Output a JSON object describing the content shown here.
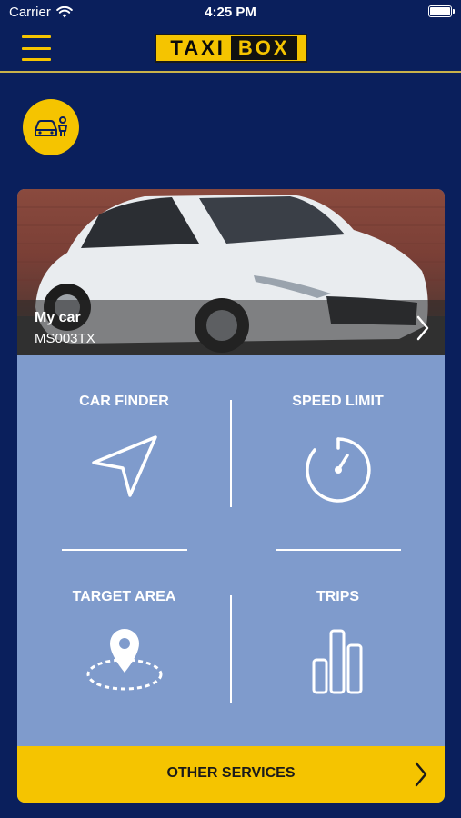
{
  "status_bar": {
    "carrier": "Carrier",
    "time": "4:25 PM"
  },
  "header": {
    "logo_taxi": "TAXI",
    "logo_box": "BOX"
  },
  "car": {
    "name": "My car",
    "plate": "MS003TX"
  },
  "tiles": [
    {
      "label": "CAR FINDER",
      "icon": "navigation-arrow-icon"
    },
    {
      "label": "SPEED LIMIT",
      "icon": "stopwatch-icon"
    },
    {
      "label": "TARGET AREA",
      "icon": "location-area-icon"
    },
    {
      "label": "TRIPS",
      "icon": "bar-chart-icon"
    }
  ],
  "other_services": {
    "label": "OTHER SERVICES"
  },
  "colors": {
    "background": "#0a1f5c",
    "accent_yellow": "#f5c400",
    "panel_blue": "#7f9bcc"
  }
}
